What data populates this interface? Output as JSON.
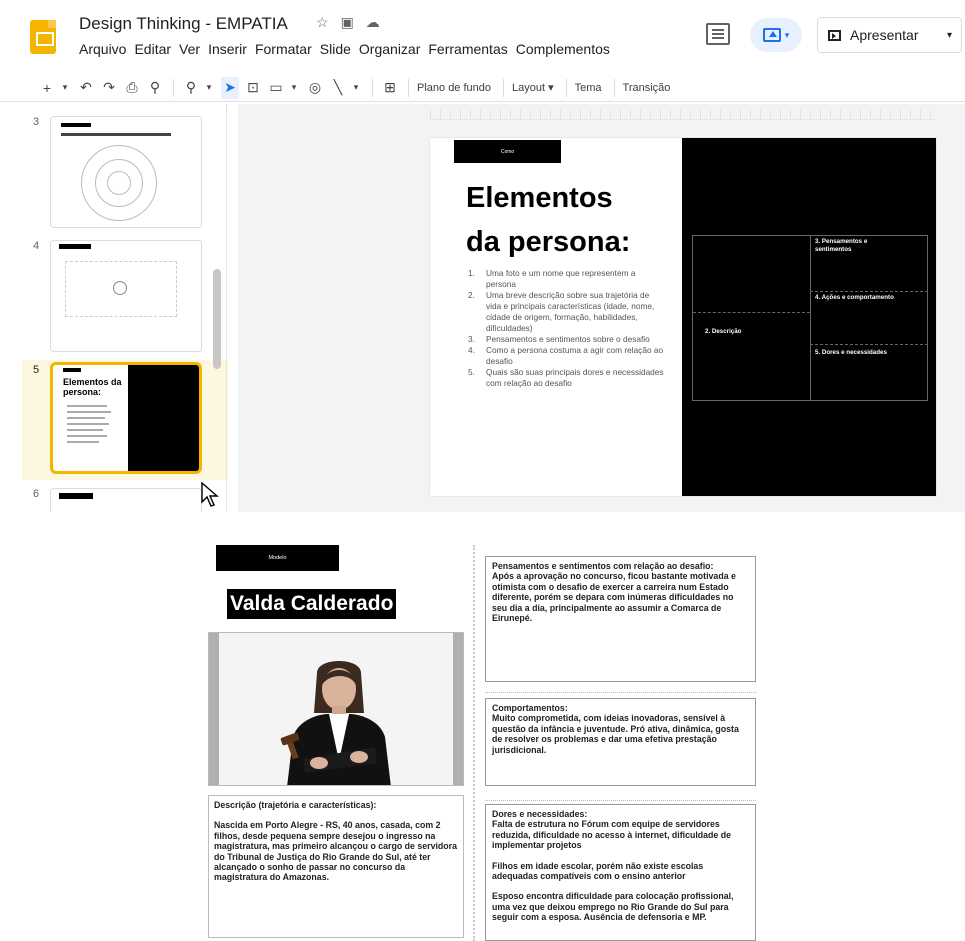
{
  "app": {
    "title": "Design Thinking - EMPATIA",
    "menu": [
      "Arquivo",
      "Editar",
      "Ver",
      "Inserir",
      "Formatar",
      "Slide",
      "Organizar",
      "Ferramentas",
      "Complementos"
    ],
    "present_label": "Apresentar",
    "accent_color": "#f4b400"
  },
  "toolbar": {
    "background_label": "Plano de fundo",
    "layout_label": "Layout",
    "theme_label": "Tema",
    "transition_label": "Transição"
  },
  "filmstrip": {
    "slides": [
      {
        "number": "3"
      },
      {
        "number": "4"
      },
      {
        "number": "5",
        "title": "Elementos da persona:",
        "selected": true
      },
      {
        "number": "6"
      }
    ]
  },
  "slide": {
    "tag": "Como",
    "title_line1": "Elementos",
    "title_line2": "da persona:",
    "list": [
      {
        "n": "1.",
        "text": "Uma foto e um nome que representem a persona"
      },
      {
        "n": "2.",
        "text": "Uma breve descrição sobre sua trajetória de vida e principais características (idade, nome, cidade de origem, formação, habilidades, dificuldades)"
      },
      {
        "n": "3.",
        "text": "Pensamentos e sentimentos sobre o desafio"
      },
      {
        "n": "4.",
        "text": "Como a persona costuma a agir com relação ao desafio"
      },
      {
        "n": "5.",
        "text": "Quais são suas principais dores e necessidades com relação ao desafio"
      }
    ],
    "grid": {
      "descricao": "2. Descrição",
      "pensamentos": "3. Pensamentos e sentimentos",
      "acoes": "4. Ações e comportamento",
      "dores": "5. Dores e necessidades"
    }
  },
  "persona": {
    "tag": "Modelo",
    "name": "Valda Calderado",
    "description_title": "Descrição (trajetória e características):",
    "description_text": "Nascida em Porto Alegre - RS, 40 anos, casada, com 2 filhos, desde pequena sempre desejou o ingresso na magistratura, mas primeiro alcançou o cargo de servidora do Tribunal de Justiça do Rio Grande do Sul, até ter alcançado o sonho de passar no concurso da magistratura do Amazonas.",
    "pensamentos_title": "Pensamentos e sentimentos com relação ao desafio:",
    "pensamentos_text": "Após a aprovação no concurso, ficou bastante motivada e otimista com o desafio de exercer a carreira num Estado diferente, porém se depara com inúmeras dificuldades no seu dia a dia, principalmente ao assumir a Comarca de Eirunepé.",
    "comportamentos_title": "Comportamentos:",
    "comportamentos_text": "Muito comprometida, com ideias inovadoras, sensível à questão da infância e juventude. Pró ativa, dinâmica, gosta de resolver os problemas e dar uma efetiva prestação  jurisdicional.",
    "dores_title": "Dores e necessidades:",
    "dores_text1": "Falta de estrutura no Fórum com equipe de servidores reduzida, dificuldade no acesso à internet, dificuldade de implementar projetos",
    "dores_text2": "Filhos em idade escolar, porém não existe escolas adequadas compatíveis com o ensino anterior",
    "dores_text3": "Esposo encontra dificuldade para colocação profissional, uma vez que deixou emprego no Rio Grande do Sul para seguir com a esposa. Ausência de defensoria e MP."
  }
}
